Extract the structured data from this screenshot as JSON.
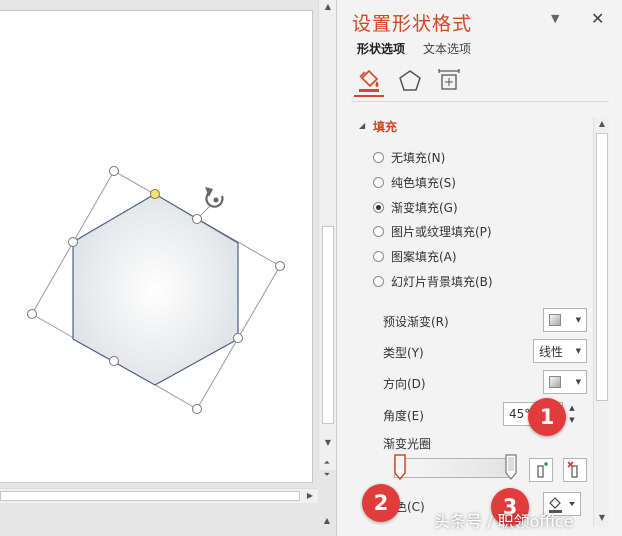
{
  "pane": {
    "title": "设置形状格式",
    "tabs": [
      {
        "label": "形状选项",
        "active": true
      },
      {
        "label": "文本选项",
        "active": false
      }
    ],
    "categories": [
      "fill-line-icon",
      "effects-pentagon-icon",
      "size-properties-icon"
    ],
    "accent_color": "#d24726"
  },
  "fill_section": {
    "title": "填充",
    "options": [
      {
        "label": "无填充(N)",
        "checked": false
      },
      {
        "label": "纯色填充(S)",
        "checked": false
      },
      {
        "label": "渐变填充(G)",
        "checked": true
      },
      {
        "label": "图片或纹理填充(P)",
        "checked": false
      },
      {
        "label": "图案填充(A)",
        "checked": false
      },
      {
        "label": "幻灯片背景填充(B)",
        "checked": false
      }
    ],
    "preset_label": "预设渐变(R)",
    "type_label": "类型(Y)",
    "type_value": "线性",
    "direction_label": "方向(D)",
    "angle_label": "角度(E)",
    "angle_value": "45°",
    "gradient_stops_label": "渐变光圈",
    "color_label": "颜色(C)"
  },
  "callouts": [
    "1",
    "2",
    "3"
  ],
  "watermark": "头条号 / 职领office"
}
